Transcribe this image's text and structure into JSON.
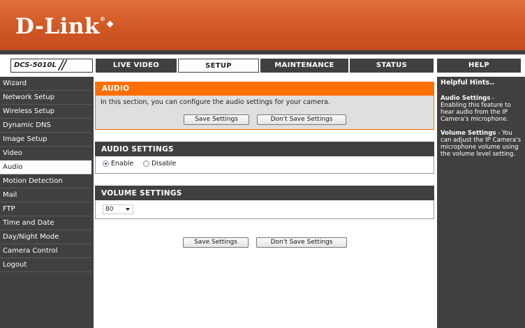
{
  "brand": {
    "name": "D-Link",
    "registered": "®"
  },
  "model": "DCS-5010L",
  "tabs": [
    {
      "label": "LIVE VIDEO"
    },
    {
      "label": "SETUP"
    },
    {
      "label": "MAINTENANCE"
    },
    {
      "label": "STATUS"
    },
    {
      "label": "HELP"
    }
  ],
  "sidebar": {
    "items": [
      {
        "label": "Wizard"
      },
      {
        "label": "Network Setup"
      },
      {
        "label": "Wireless Setup"
      },
      {
        "label": "Dynamic DNS"
      },
      {
        "label": "Image Setup"
      },
      {
        "label": "Video"
      },
      {
        "label": "Audio"
      },
      {
        "label": "Motion Detection"
      },
      {
        "label": "Mail"
      },
      {
        "label": "FTP"
      },
      {
        "label": "Time and Date"
      },
      {
        "label": "Day/Night Mode"
      },
      {
        "label": "Camera Control"
      },
      {
        "label": "Logout"
      }
    ]
  },
  "audio": {
    "title": "AUDIO",
    "description": "In this section, you can configure the audio settings for your camera.",
    "save_label": "Save Settings",
    "dont_save_label": "Don't Save Settings"
  },
  "audio_settings": {
    "title": "AUDIO SETTINGS",
    "enable_label": "Enable",
    "disable_label": "Disable",
    "selected": "Enable"
  },
  "volume_settings": {
    "title": "VOLUME SETTINGS",
    "value": "80"
  },
  "footer_buttons": {
    "save_label": "Save Settings",
    "dont_save_label": "Don't Save Settings"
  },
  "help": {
    "title": "Helpful Hints..",
    "audio_hint_title": "Audio Settings",
    "audio_hint_text": " - Enabling this feature to hear audio from the IP Camera's microphone.",
    "volume_hint_title": "Volume Settings",
    "volume_hint_text": " - You can adjust the IP Camera's microphone volume using the volume level setting."
  },
  "colors": {
    "accent": "#ff6f00",
    "header": "#d25a26",
    "dark": "#404040"
  }
}
